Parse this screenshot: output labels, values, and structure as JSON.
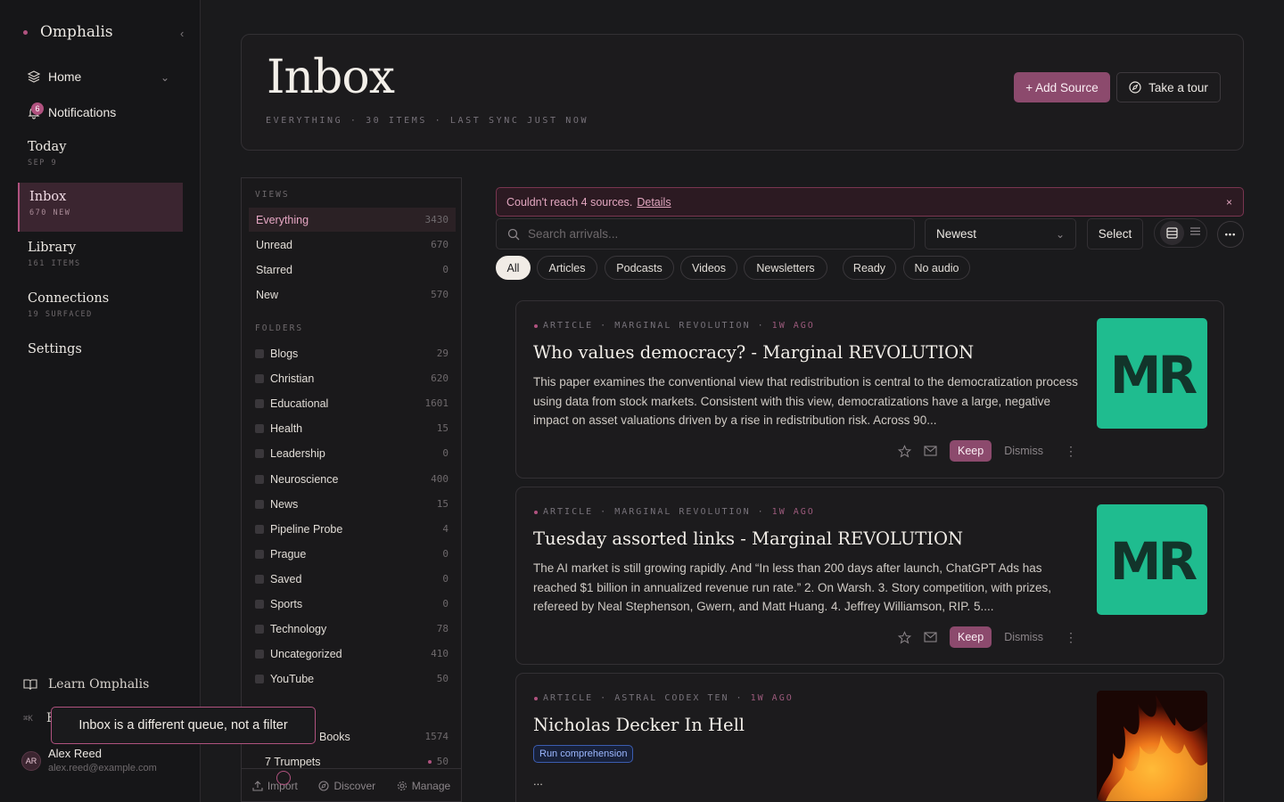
{
  "sidebar": {
    "brand": "Omphalis",
    "home": "Home",
    "notifications": "Notifications",
    "notif_count": "6",
    "nav": [
      {
        "title": "Today",
        "sub": "SEP 9"
      },
      {
        "title": "Inbox",
        "sub": "670 NEW"
      },
      {
        "title": "Library",
        "sub": "161 ITEMS"
      },
      {
        "title": "Connections",
        "sub": "19 SURFACED"
      },
      {
        "title": "Settings",
        "sub": ""
      }
    ],
    "learn": "Learn Omphalis",
    "shortcut": "⌘K",
    "shortcut_label": "E",
    "user": {
      "initials": "AR",
      "name": "Alex Reed",
      "email": "alex.reed@example.com"
    }
  },
  "header": {
    "title": "Inbox",
    "meta": "EVERYTHING · 30 ITEMS · LAST SYNC JUST NOW",
    "add_source": "+ Add Source",
    "tour": "Take a tour"
  },
  "panel": {
    "views_label": "VIEWS",
    "views": [
      {
        "label": "Everything",
        "count": "3430"
      },
      {
        "label": "Unread",
        "count": "670"
      },
      {
        "label": "Starred",
        "count": "0"
      },
      {
        "label": "New",
        "count": "570"
      }
    ],
    "folders_label": "FOLDERS",
    "folders": [
      {
        "label": "Blogs",
        "count": "29"
      },
      {
        "label": "Christian",
        "count": "620"
      },
      {
        "label": "Educational",
        "count": "1601"
      },
      {
        "label": "Health",
        "count": "15"
      },
      {
        "label": "Leadership",
        "count": "0"
      },
      {
        "label": "Neuroscience",
        "count": "400"
      },
      {
        "label": "News",
        "count": "15"
      },
      {
        "label": "Pipeline Probe",
        "count": "4"
      },
      {
        "label": "Prague",
        "count": "0"
      },
      {
        "label": "Saved",
        "count": "0"
      },
      {
        "label": "Sports",
        "count": "0"
      },
      {
        "label": "Technology",
        "count": "78"
      },
      {
        "label": "Uncategorized",
        "count": "410"
      },
      {
        "label": "YouTube",
        "count": "50"
      }
    ],
    "extra": [
      {
        "label": "Books",
        "count": "1574"
      },
      {
        "label": "7 Trumpets",
        "count": "50"
      }
    ],
    "footer": {
      "import": "Import",
      "discover": "Discover",
      "manage": "Manage"
    }
  },
  "tooltip": "Inbox is a different queue, not a filter",
  "feed": {
    "error_text": "Couldn't reach 4 sources.",
    "error_link": "Details",
    "error_close": "×",
    "search_placeholder": "Search arrivals...",
    "sort": "Newest",
    "select": "Select",
    "more": "•••",
    "chips": [
      "All",
      "Articles",
      "Podcasts",
      "Videos",
      "Newsletters",
      "Ready",
      "No audio"
    ],
    "cards": [
      {
        "kicker": "ARTICLE · MARGINAL REVOLUTION ·",
        "ago": "1W AGO",
        "title": "Who values democracy? - Marginal REVOLUTION",
        "desc": "This paper examines the conventional view that redistribution is central to the democratization process using data from stock markets. Consistent with this view, democratizations have a large, negative impact on asset valuations driven by a rise in redistribution risk. Across 90...",
        "thumb": "MR",
        "keep": "Keep",
        "dismiss": "Dismiss"
      },
      {
        "kicker": "ARTICLE · MARGINAL REVOLUTION ·",
        "ago": "1W AGO",
        "title": "Tuesday assorted links - Marginal REVOLUTION",
        "desc": "The AI market is still growing rapidly. And “In less than 200 days after launch, ChatGPT Ads has reached $1 billion in annualized revenue run rate.” 2. On Warsh. 3. Story competition, with prizes, refereed by Neal Stephenson, Gwern, and Matt Huang. 4. Jeffrey Williamson, RIP. 5....",
        "thumb": "MR",
        "keep": "Keep",
        "dismiss": "Dismiss"
      },
      {
        "kicker": "ARTICLE · ASTRAL CODEX TEN ·",
        "ago": "1W AGO",
        "title": "Nicholas Decker In Hell",
        "badge": "Run comprehension",
        "desc": "..."
      }
    ]
  },
  "colors": {
    "accent": "#8c4a6d",
    "accent_light": "#b0527f",
    "bg": "#1a1a1c",
    "thumb_green": "#1fbc8f"
  }
}
